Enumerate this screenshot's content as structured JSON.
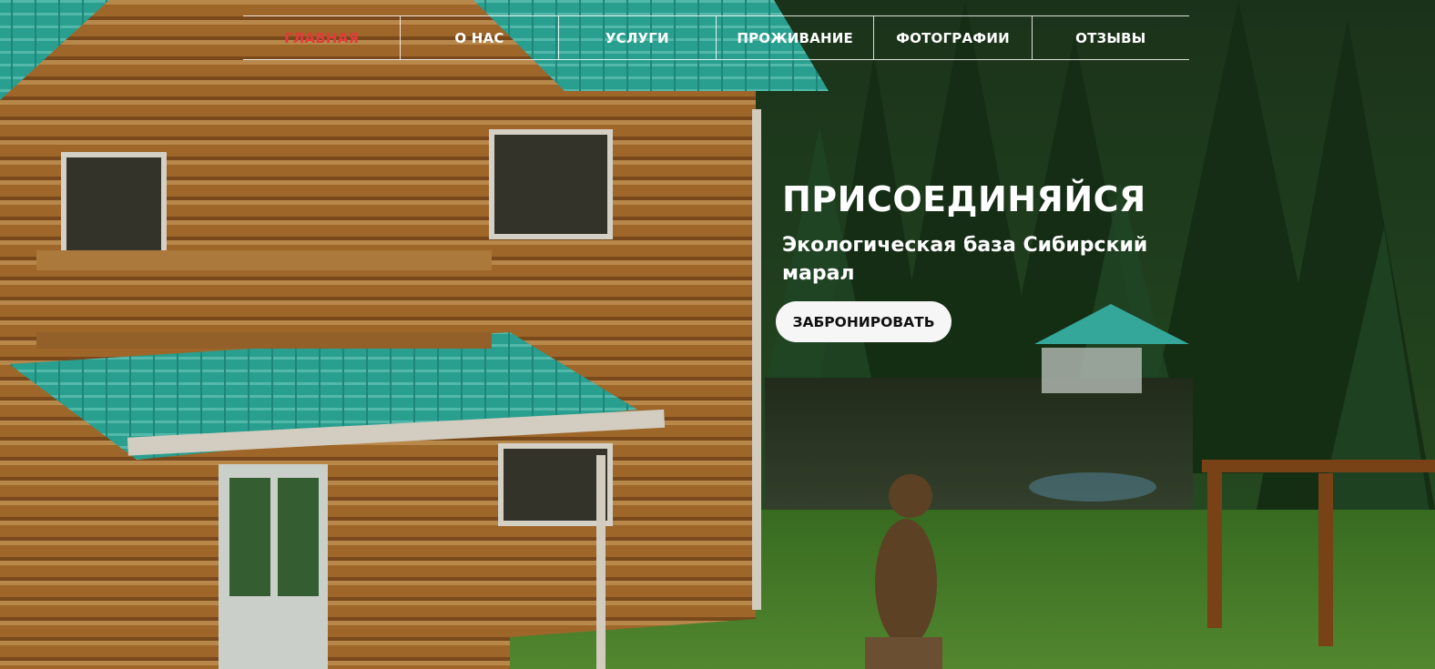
{
  "nav": {
    "items": [
      {
        "label": "ГЛАВНАЯ",
        "active": true
      },
      {
        "label": "О НАС",
        "active": false
      },
      {
        "label": "УСЛУГИ",
        "active": false
      },
      {
        "label": "ПРОЖИВАНИЕ",
        "active": false
      },
      {
        "label": "ФОТОГРАФИИ",
        "active": false
      },
      {
        "label": "ОТЗЫВЫ",
        "active": false
      }
    ]
  },
  "hero": {
    "title": "ПРИСОЕДИНЯЙСЯ",
    "subtitle": "Экологическая база Сибирский марал",
    "cta_label": "ЗАБРОНИРОВАТЬ",
    "colors": {
      "active_nav": "#e23b3b",
      "roof": "#2fb7a6",
      "wood": "#b97a34",
      "forest": "#1f3f1c",
      "grass": "#4a8a2a"
    }
  }
}
